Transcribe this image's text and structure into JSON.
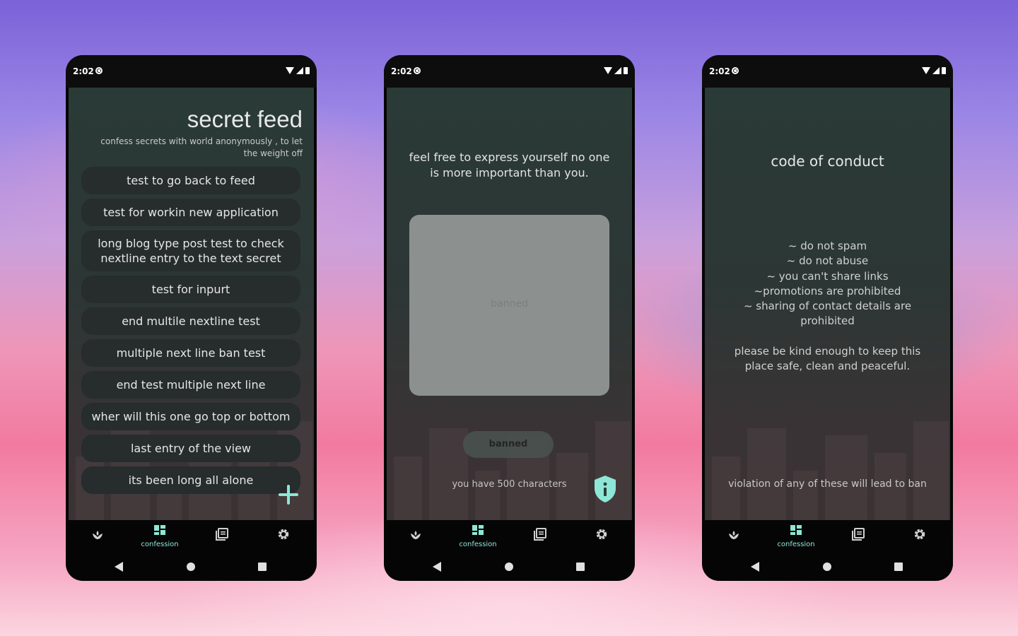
{
  "status_bar": {
    "time": "2:02"
  },
  "feed": {
    "title": "secret feed",
    "subtitle": "confess secrets with world anonymously , to let the weight off",
    "posts": [
      "test to go back to feed",
      "test for workin new application",
      "long blog type post test to check nextline entry to the text secret",
      "test for inpurt",
      "end multile nextline test",
      "multiple next line ban test",
      "end test multiple next line",
      "wher will this one go top or bottom",
      "last entry of the view",
      "its been long all alone"
    ]
  },
  "compose": {
    "prompt": "feel free to express yourself no one is more important than you.",
    "placeholder": "banned",
    "submit_label": "banned",
    "char_count": "you have 500 characters"
  },
  "conduct": {
    "title": "code of conduct",
    "rules": [
      "~ do not spam",
      "~ do not abuse",
      "~ you can't share links",
      "~promotions are prohibited",
      "~ sharing of contact details are prohibited"
    ],
    "note": "please be kind enough to keep this place safe, clean and peaceful.",
    "footer": "violation of any of these will lead to ban"
  },
  "nav": {
    "active_label": "confession",
    "items": [
      "sprout-icon",
      "dashboard-icon",
      "articles-icon",
      "gear-icon"
    ]
  },
  "colors": {
    "accent": "#8ee6d6",
    "screen_bg": "#2a3a37",
    "card_bg": "#262d2c"
  }
}
